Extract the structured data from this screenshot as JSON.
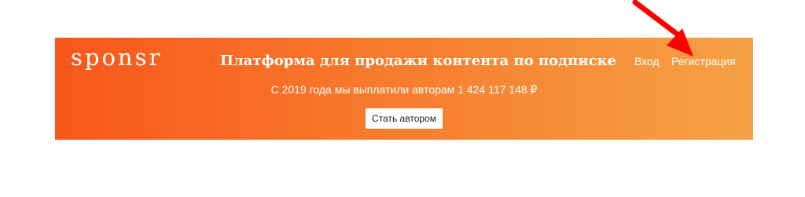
{
  "header": {
    "logo": "sponsr",
    "headline": "Платформа для продажи контента по подписке",
    "payout_text": "С 2019 года мы выплатили авторам 1 424 117 148 ₽",
    "cta_label": "Стать автором",
    "nav": {
      "login": "Вход",
      "register": "Регистрация"
    }
  },
  "colors": {
    "gradient_start": "#f9561b",
    "gradient_end": "#f5a145",
    "annotation_arrow": "#ff0000"
  }
}
